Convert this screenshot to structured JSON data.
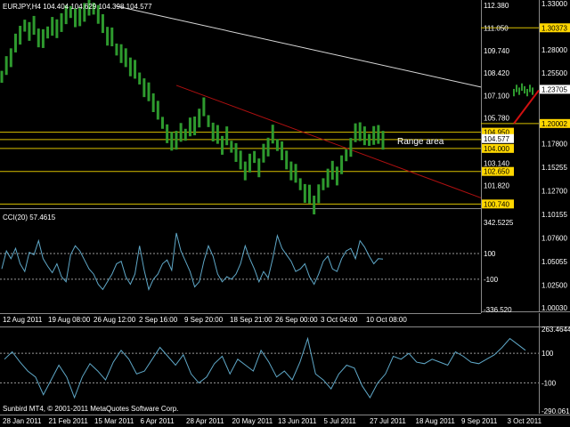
{
  "colors": {
    "background": "#000000",
    "candles": "#2e9a2e",
    "cci": "#5fa8c8",
    "level_lines": "#d8c000",
    "trend_line": "#b01010",
    "upper_trend_line": "#d8d8d8",
    "grid_dotted": "#9a9a9a",
    "label_box": "#ffd700",
    "text": "#ffffff"
  },
  "main_chart": {
    "title": "EURJPY,H4  104.404 104.629 104.398 104.577",
    "annotation": "Range area",
    "y_ticks": [
      "112.380",
      "111.050",
      "109.740",
      "108.420",
      "107.100",
      "105.780",
      "103.140",
      "101.820"
    ],
    "price_labels": [
      {
        "text": "104.950",
        "value": 104.95,
        "style": "box"
      },
      {
        "text": "104.577",
        "value": 104.577,
        "style": "white"
      },
      {
        "text": "104.000",
        "value": 104.0,
        "style": "box"
      },
      {
        "text": "102.650",
        "value": 102.65,
        "style": "box"
      },
      {
        "text": "100.740",
        "value": 100.74,
        "style": "box"
      }
    ],
    "x_ticks": [
      "12 Aug 2011",
      "19 Aug 08:00",
      "26 Aug 12:00",
      "2 Sep 16:00",
      "9 Sep 20:00",
      "18 Sep 21:00",
      "26 Sep 00:00",
      "3 Oct 04:00",
      "10 Oct 08:00"
    ]
  },
  "cci_panel": {
    "title": "CCI(20) 57.4615",
    "y_labels": [
      {
        "text": "342.5225",
        "value": 342.52
      },
      {
        "text": "100",
        "value": 100
      },
      {
        "text": "-100",
        "value": -100
      },
      {
        "text": "-336.520",
        "value": -336.52
      }
    ]
  },
  "right_chart": {
    "y_ticks": [
      "1.33000",
      "1.30373",
      "1.28000",
      "1.25500",
      "1.23705",
      "1.20002",
      "1.17800",
      "1.15255",
      "1.12700",
      "1.10155",
      "1.07600",
      "1.05055",
      "1.02500",
      "1.00030"
    ],
    "boxed": [
      "1.30373",
      "1.20002"
    ],
    "current": "1.23705"
  },
  "bottom_chart": {
    "y_labels": [
      {
        "text": "263.4644",
        "value": 263.46
      },
      {
        "text": "100",
        "value": 100
      },
      {
        "text": "-100",
        "value": -100
      },
      {
        "text": "-290.061",
        "value": -290.06
      }
    ],
    "x_ticks": [
      "28 Jan 2011",
      "21 Feb 2011",
      "15 Mar 2011",
      "6 Apr 2011",
      "28 Apr 2011",
      "20 May 2011",
      "13 Jun 2011",
      "5 Jul 2011",
      "27 Jul 2011",
      "18 Aug 2011",
      "9 Sep 2011",
      "3 Oct 2011"
    ],
    "footer": "Sunbird MT4, © 2001-2011 MetaQuotes Software Corp."
  },
  "chart_data": [
    {
      "type": "line",
      "title": "EURJPY,H4  104.404 104.629 104.398 104.577",
      "series": [
        {
          "values": [
            108.2,
            108.9,
            109.2,
            110.3,
            110.6,
            111.2,
            110.9,
            111.1,
            110.6,
            110.4,
            110.8,
            111.2,
            110.9,
            111.5,
            111.8,
            112.0,
            111.7,
            111.6,
            112.1,
            112.3,
            112.2,
            111.9,
            111.2,
            110.7,
            110.5,
            109.8,
            109.6,
            109.2,
            108.9,
            108.6,
            108.1,
            107.6,
            107.2,
            106.8,
            106.2,
            105.5,
            104.9,
            104.3,
            104.6,
            104.9,
            104.8,
            105.3,
            105.2,
            105.9,
            106.4,
            105.6,
            105.0,
            104.7,
            104.3,
            104.7,
            104.1,
            103.8,
            103.2,
            102.8,
            103.1,
            103.5,
            102.9,
            103.6,
            104.2,
            104.8,
            104.2,
            103.9,
            103.2,
            102.8,
            102.5,
            101.9,
            101.4,
            101.2,
            100.8,
            101.3,
            101.9,
            102.3,
            102.6,
            102.5,
            103.0,
            103.6,
            104.1,
            104.8,
            105.1,
            104.7,
            104.5,
            104.8,
            104.7,
            104.6
          ]
        }
      ],
      "ylim": [
        100.6,
        112.6
      ]
    },
    {
      "type": "line",
      "title": "CCI(20) 57.4615",
      "series": [
        {
          "values": [
            -20,
            120,
            60,
            140,
            20,
            -40,
            110,
            90,
            200,
            60,
            0,
            -50,
            20,
            -80,
            -120,
            90,
            160,
            120,
            50,
            -20,
            -60,
            -140,
            -180,
            -120,
            -60,
            20,
            40,
            -80,
            -140,
            -60,
            160,
            -30,
            -180,
            -100,
            -60,
            20,
            50,
            -30,
            260,
            120,
            40,
            -40,
            -160,
            -120,
            40,
            160,
            80,
            -60,
            -120,
            -80,
            -100,
            -60,
            20,
            160,
            60,
            -20,
            -120,
            -40,
            -90,
            60,
            240,
            140,
            90,
            40,
            -40,
            -20,
            20,
            -80,
            -140,
            -60,
            40,
            80,
            -20,
            -40,
            60,
            120,
            140,
            60,
            200,
            150,
            80,
            20,
            60,
            57
          ]
        }
      ],
      "ylim": [
        -336.52,
        342.52
      ]
    },
    {
      "type": "line",
      "series": [
        {
          "values": [
            60,
            110,
            40,
            -20,
            -60,
            -180,
            -80,
            20,
            -60,
            -200,
            -60,
            30,
            -20,
            -80,
            40,
            120,
            60,
            -40,
            -20,
            60,
            140,
            80,
            20,
            90,
            -40,
            -100,
            -60,
            30,
            80,
            -40,
            60,
            20,
            -20,
            120,
            40,
            -60,
            -20,
            -80,
            40,
            200,
            -40,
            -80,
            -140,
            -40,
            20,
            0,
            -120,
            -200,
            -100,
            -40,
            80,
            60,
            100,
            40,
            30,
            60,
            40,
            20,
            110,
            80,
            40,
            30,
            60,
            90,
            140,
            200,
            160,
            120
          ]
        }
      ],
      "ylim": [
        -290.061,
        263.4644
      ]
    }
  ]
}
